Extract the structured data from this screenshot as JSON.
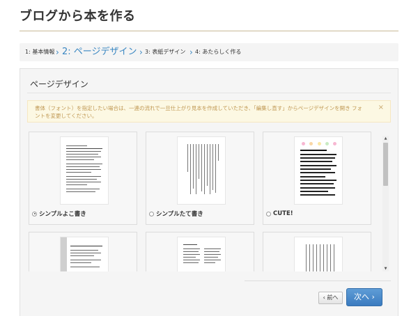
{
  "page": {
    "title": "ブログから本を作る"
  },
  "steps": [
    {
      "label": "1: 基本情報"
    },
    {
      "label": "2: ページデザイン"
    },
    {
      "label": "3: 表紙デザイン"
    },
    {
      "label": "4: あたらしく作る"
    }
  ],
  "step_separator": "›",
  "panel": {
    "title": "ページデザイン",
    "alert_text": "書体（フォント）を指定したい場合は、一連の流れで一旦仕上がり見本を作成していただき、「編集し直す」からページデザインを開き フォントを変更してください。",
    "alert_close": "×"
  },
  "designs": [
    {
      "label": "シンプルよこ書き",
      "selected": true
    },
    {
      "label": "シンプルたて書き",
      "selected": false
    },
    {
      "label": "CUTE!",
      "selected": false
    },
    {
      "label": "",
      "selected": false
    },
    {
      "label": "",
      "selected": false
    },
    {
      "label": "",
      "selected": false
    }
  ],
  "scroll": {
    "up": "▲",
    "down": "▼"
  },
  "buttons": {
    "prev": "‹ 前へ",
    "next": "次へ ›"
  },
  "colors": {
    "accent": "#3a87c2",
    "alert_bg": "#fcf8e3",
    "alert_text": "#c09853",
    "next_button": "#4a8ccb"
  }
}
